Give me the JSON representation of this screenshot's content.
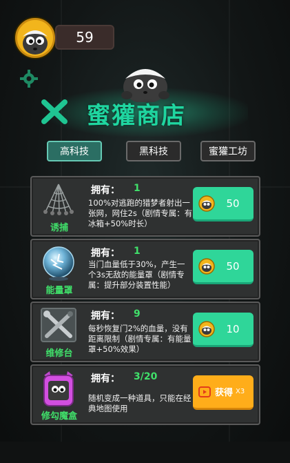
{
  "header": {
    "coins": "59"
  },
  "shop": {
    "title": "蜜獾商店"
  },
  "tabs": [
    {
      "label": "高科技",
      "active": true
    },
    {
      "label": "黑科技",
      "active": false
    },
    {
      "label": "蜜獾工坊",
      "active": false
    }
  ],
  "items": [
    {
      "name": "诱捕",
      "own_label": "拥有：",
      "own_value": "1",
      "desc": "100%对逃跑的猎梦者射出一张网，网住2s（剧情专属：有冰箱+50%时长）",
      "price": "50",
      "icon": "net-icon"
    },
    {
      "name": "能量罩",
      "own_label": "拥有：",
      "own_value": "1",
      "desc": "当门血量低于30%，产生一个3s无敌的能量罩（剧情专属：提升部分装置性能）",
      "price": "50",
      "icon": "energy-orb-icon"
    },
    {
      "name": "维修台",
      "own_label": "拥有：",
      "own_value": "9",
      "desc": "每秒恢复门2%的血量，没有距离限制（剧情专属：有能量罩+50%效果）",
      "price": "10",
      "icon": "wrench-screwdriver-icon"
    },
    {
      "name": "修勾魔盒",
      "own_label": "拥有：",
      "own_value": "3/20",
      "desc": "随机变成一种道具，只能在经典地图使用",
      "get_label": "获得",
      "multiplier": "X3",
      "icon": "magic-box-icon"
    }
  ],
  "colors": {
    "accent_green": "#2fd699",
    "title_green": "#1fd6a0",
    "video_orange": "#ffad1a"
  }
}
